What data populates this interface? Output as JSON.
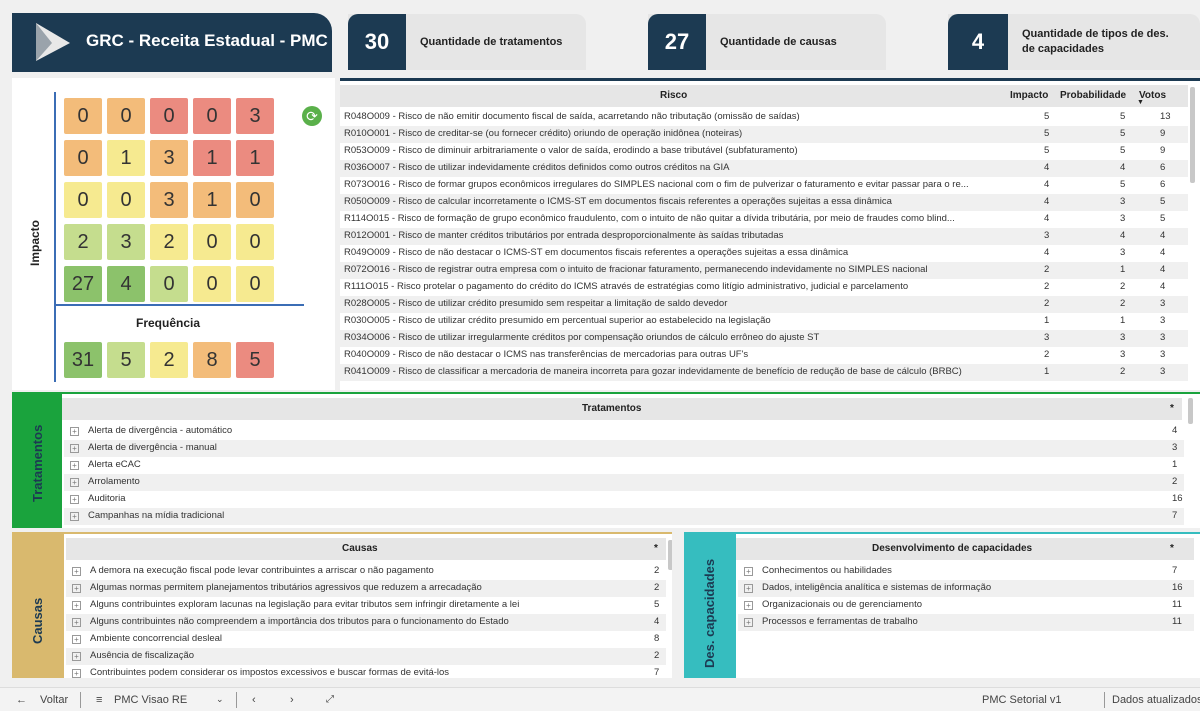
{
  "header": {
    "title": "GRC - Receita Estadual - PMC",
    "kpis": [
      {
        "value": "30",
        "label": "Quantidade de tratamentos"
      },
      {
        "value": "27",
        "label": "Quantidade de causas"
      },
      {
        "value": "4",
        "label": "Quantidade de tipos de des. de capacidades"
      }
    ]
  },
  "heatmap": {
    "y_label": "Impacto",
    "x_label": "Frequência",
    "rows": [
      [
        "0",
        "0",
        "0",
        "0",
        "3"
      ],
      [
        "0",
        "1",
        "3",
        "1",
        "1"
      ],
      [
        "0",
        "0",
        "3",
        "1",
        "0"
      ],
      [
        "2",
        "3",
        "2",
        "0",
        "0"
      ],
      [
        "27",
        "4",
        "0",
        "0",
        "0"
      ]
    ],
    "totals": [
      "31",
      "5",
      "2",
      "8",
      "5"
    ],
    "colors": {
      "green_dark": "#8cc26b",
      "green_light": "#c5dd8e",
      "yellow": "#f6ea90",
      "orange": "#f3bc7a",
      "red": "#eb8b80"
    }
  },
  "risk_table": {
    "headers": {
      "risco": "Risco",
      "impacto": "Impacto",
      "probabilidade": "Probabilidade",
      "votos": "Votos"
    },
    "rows": [
      {
        "risco": "R048O009 - Risco de não emitir documento fiscal de saída, acarretando não tributação (omissão de saídas)",
        "impacto": "5",
        "prob": "5",
        "votos": "13"
      },
      {
        "risco": "R010O001 - Risco de creditar-se (ou fornecer crédito) oriundo de operação inidônea (noteiras)",
        "impacto": "5",
        "prob": "5",
        "votos": "9"
      },
      {
        "risco": "R053O009 - Risco de diminuir arbitrariamente o valor de saída, erodindo a base tributável (subfaturamento)",
        "impacto": "5",
        "prob": "5",
        "votos": "9"
      },
      {
        "risco": "R036O007 - Risco de utilizar indevidamente créditos definidos como outros créditos na GIA",
        "impacto": "4",
        "prob": "4",
        "votos": "6"
      },
      {
        "risco": "R073O016 - Risco de formar grupos econômicos irregulares do SIMPLES nacional com o fim de pulverizar o faturamento e evitar passar para o re...",
        "impacto": "4",
        "prob": "5",
        "votos": "6"
      },
      {
        "risco": "R050O009 - Risco de calcular incorretamente o ICMS-ST em documentos fiscais referentes a operações sujeitas a essa dinâmica",
        "impacto": "4",
        "prob": "3",
        "votos": "5"
      },
      {
        "risco": "R114O015 - Risco de formação de grupo econômico fraudulento, com o intuito de não quitar a dívida tributária, por meio de fraudes como blind...",
        "impacto": "4",
        "prob": "3",
        "votos": "5"
      },
      {
        "risco": "R012O001 - Risco de manter créditos tributários por entrada desproporcionalmente às saídas tributadas",
        "impacto": "3",
        "prob": "4",
        "votos": "4"
      },
      {
        "risco": "R049O009 - Risco de não destacar o ICMS-ST em documentos fiscais referentes a operações sujeitas a essa dinâmica",
        "impacto": "4",
        "prob": "3",
        "votos": "4"
      },
      {
        "risco": "R072O016 - Risco de registrar outra empresa com o intuito de fracionar faturamento, permanecendo indevidamente no SIMPLES nacional",
        "impacto": "2",
        "prob": "1",
        "votos": "4"
      },
      {
        "risco": "R111O015 - Risco protelar o pagamento do crédito do ICMS através de estratégias como litígio administrativo, judicial e parcelamento",
        "impacto": "2",
        "prob": "2",
        "votos": "4"
      },
      {
        "risco": "R028O005 - Risco de utilizar crédito presumido sem respeitar a limitação de saldo devedor",
        "impacto": "2",
        "prob": "2",
        "votos": "3"
      },
      {
        "risco": "R030O005 - Risco de utilizar crédito presumido em percentual superior ao estabelecido na legislação",
        "impacto": "1",
        "prob": "1",
        "votos": "3"
      },
      {
        "risco": "R034O006 - Risco de utilizar irregularmente créditos por compensação oriundos de cálculo errôneo do ajuste ST",
        "impacto": "3",
        "prob": "3",
        "votos": "3"
      },
      {
        "risco": "R040O009 - Risco de não destacar o ICMS nas transferências de mercadorias para outras UF's",
        "impacto": "2",
        "prob": "3",
        "votos": "3"
      },
      {
        "risco": "R041O009 - Risco de classificar a mercadoria de maneira incorreta para gozar indevidamente de benefício de redução de base de cálculo (BRBC)",
        "impacto": "1",
        "prob": "2",
        "votos": "3"
      }
    ]
  },
  "tratamentos": {
    "side_label": "Tratamentos",
    "header": "Tratamentos",
    "col": "*",
    "rows": [
      {
        "label": "Alerta de divergência - automático",
        "value": "4"
      },
      {
        "label": "Alerta de divergência - manual",
        "value": "3"
      },
      {
        "label": "Alerta eCAC",
        "value": "1"
      },
      {
        "label": "Arrolamento",
        "value": "2"
      },
      {
        "label": "Auditoria",
        "value": "16"
      },
      {
        "label": "Campanhas na mídia tradicional",
        "value": "7"
      }
    ]
  },
  "causas": {
    "side_label": "Causas",
    "header": "Causas",
    "col": "*",
    "rows": [
      {
        "label": "A demora na execução fiscal pode levar contribuintes a arriscar o não pagamento",
        "value": "2"
      },
      {
        "label": "Algumas normas permitem planejamentos tributários agressivos que reduzem a arrecadação",
        "value": "2"
      },
      {
        "label": "Alguns contribuintes exploram lacunas na legislação para evitar tributos sem infringir diretamente a lei",
        "value": "5"
      },
      {
        "label": "Alguns contribuintes não compreendem a importância dos tributos para o funcionamento do Estado",
        "value": "4"
      },
      {
        "label": "Ambiente concorrencial desleal",
        "value": "8"
      },
      {
        "label": "Ausência de fiscalização",
        "value": "2"
      },
      {
        "label": "Contribuintes podem considerar os impostos excessivos e buscar formas de evitá-los",
        "value": "7"
      }
    ]
  },
  "capacidades": {
    "side_label": "Des. capacidades",
    "header": "Desenvolvimento de capacidades",
    "col": "*",
    "rows": [
      {
        "label": "Conhecimentos ou habilidades",
        "value": "7"
      },
      {
        "label": "Dados, inteligência analítica e sistemas de informação",
        "value": "16"
      },
      {
        "label": "Organizacionais ou de gerenciamento",
        "value": "11"
      },
      {
        "label": "Processos e ferramentas de trabalho",
        "value": "11"
      }
    ]
  },
  "footer": {
    "back": "Voltar",
    "page": "PMC Visao RE",
    "report": "PMC Setorial v1",
    "status": "Dados atualizados"
  }
}
